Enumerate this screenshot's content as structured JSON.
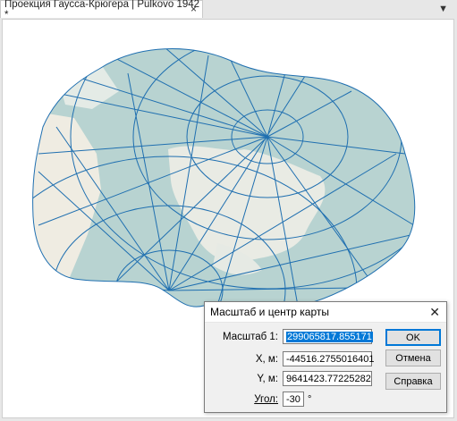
{
  "tab": {
    "title": "Проекция Гаусса-Крюгера | Pulkovo 1942 *",
    "close": "×"
  },
  "menu_arrow": "▼",
  "dialog": {
    "title": "Масштаб и центр карты",
    "close": "✕",
    "scale_label": "Масштаб 1:",
    "scale_value": "299065817.855171",
    "x_label": "X, м:",
    "x_value": "-44516.2755016401",
    "y_label": "Y, м:",
    "y_value": "9641423.77225282",
    "angle_label": "Угол:",
    "angle_value": "-30",
    "angle_unit": "°",
    "ok": "OK",
    "cancel": "Отмена",
    "help": "Справка"
  },
  "colors": {
    "ocean": "#b8d3d1",
    "land": "#efece2",
    "grid": "#1f6fb0",
    "highlight": "#0078d7"
  }
}
